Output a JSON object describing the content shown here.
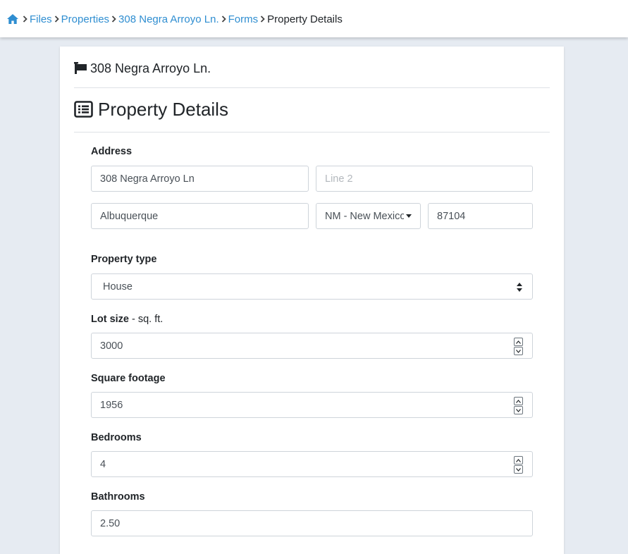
{
  "breadcrumb": {
    "items": [
      "Files",
      "Properties",
      "308 Negra Arroyo Ln.",
      "Forms"
    ],
    "current": "Property Details"
  },
  "file_title": "308 Negra Arroyo Ln.",
  "section_title": "Property Details",
  "address": {
    "label": "Address",
    "line1": "308 Negra Arroyo Ln",
    "line2_placeholder": "Line 2",
    "city": "Albuquerque",
    "state": "NM - New Mexico",
    "zip": "87104"
  },
  "property_type": {
    "label": "Property type",
    "value": "House"
  },
  "lot_size": {
    "label": "Lot size",
    "unit": " - sq. ft.",
    "value": "3000"
  },
  "square_footage": {
    "label": "Square footage",
    "value": "1956"
  },
  "bedrooms": {
    "label": "Bedrooms",
    "value": "4"
  },
  "bathrooms": {
    "label": "Bathrooms",
    "value": "2.50"
  },
  "colors": {
    "link": "#2f8ed1",
    "page_bg": "#e6ebf2"
  }
}
